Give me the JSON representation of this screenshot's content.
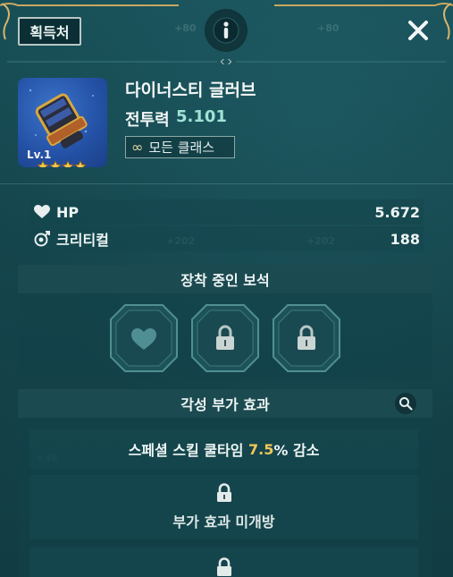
{
  "header": {
    "source_button": "획득처",
    "info_icon": "info-icon",
    "close_icon": "close-icon"
  },
  "item": {
    "name": "다이너스티 글러브",
    "power_label": "전투력",
    "power_value": "5.101",
    "class_label": "모든 클래스",
    "level": "Lv.1",
    "stars": 4
  },
  "stats": [
    {
      "icon": "heart-icon",
      "label": "HP",
      "value": "5.672"
    },
    {
      "icon": "crit-icon",
      "label": "크리티컬",
      "value": "188"
    }
  ],
  "gems": {
    "title": "장착 중인 보석",
    "sockets": [
      "heart-socket",
      "locked-socket",
      "locked-socket"
    ]
  },
  "awakening": {
    "title": "각성 부가 효과",
    "effect_prefix": "스페셜 스킬 쿨타임 ",
    "effect_value": "7.5",
    "effect_suffix": "% 감소",
    "locked_label": "부가 효과 미개방"
  },
  "colors": {
    "power": "#9fe3d6",
    "percent": "#f1c75a",
    "gold": "#d9b46a"
  }
}
